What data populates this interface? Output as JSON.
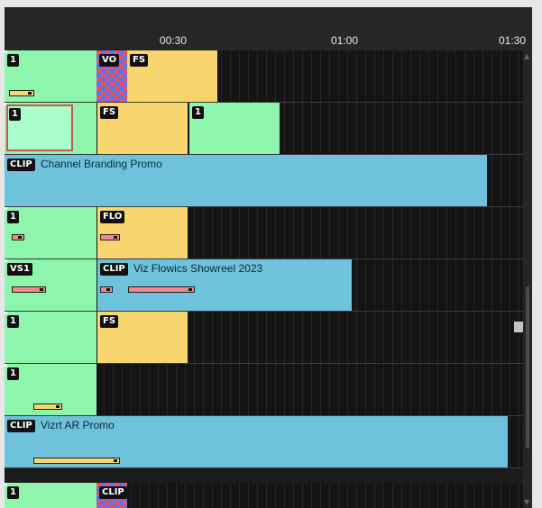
{
  "ruler": {
    "ticks": [
      "00:30",
      "01:00",
      "01:30"
    ]
  },
  "tracks": {
    "t1": {
      "c1": "1",
      "c2": "VO",
      "c3": "FS"
    },
    "t2": {
      "c1": "1",
      "c2": "FS",
      "c3": "1"
    },
    "t3": {
      "badge": "CLIP",
      "title": "Channel Branding Promo"
    },
    "t4": {
      "c1": "1",
      "c2": "FLO"
    },
    "t5": {
      "c1": "VS1",
      "badge": "CLIP",
      "title": "Viz Flowics Showreel 2023"
    },
    "t6": {
      "c1": "1",
      "c2": "FS"
    },
    "t7": {
      "c1": "1"
    },
    "t8": {
      "badge": "CLIP",
      "title": "Vizrt AR Promo"
    },
    "t9": {
      "c1": "1",
      "c2": "CLIP"
    }
  },
  "colors": {
    "graphic_clip": "#8df5ac",
    "fullscreen_clip": "#f8d56e",
    "video_clip": "#6fc2dc",
    "selected_border": "#d05050"
  }
}
